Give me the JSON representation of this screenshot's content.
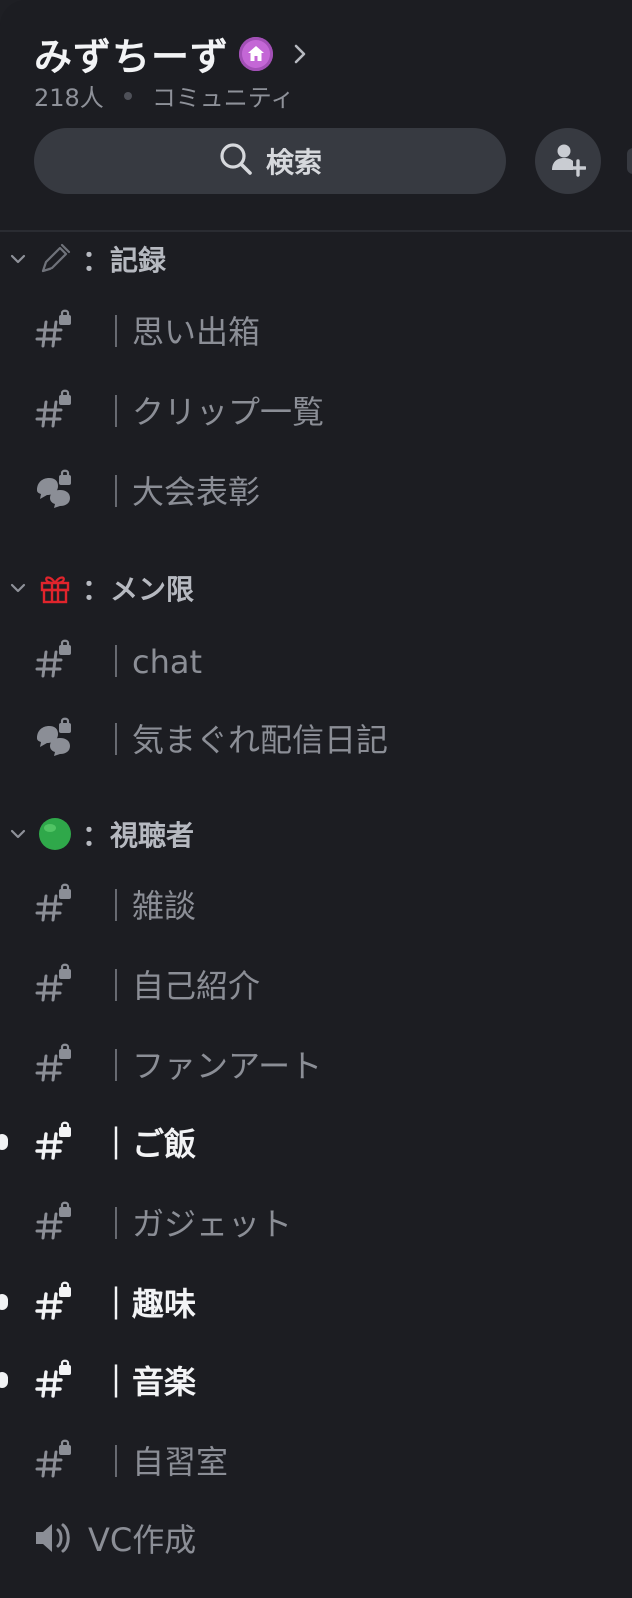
{
  "server": {
    "name": "みずちーず",
    "members": "218人",
    "type": "コミュニティ"
  },
  "search": {
    "label": "検索"
  },
  "categories": [
    {
      "name": "：記録",
      "emoji": "pencil-icon"
    },
    {
      "name": "：メン限",
      "emoji": "gift-icon"
    },
    {
      "name": "：視聴者",
      "emoji": "green-circle-icon"
    }
  ],
  "channels": [
    {
      "name": "｜思い出箱",
      "type": "text-locked"
    },
    {
      "name": "｜クリップ一覧",
      "type": "text-locked"
    },
    {
      "name": "｜大会表彰",
      "type": "forum-locked"
    },
    {
      "name": "｜chat",
      "type": "text-locked"
    },
    {
      "name": "｜気まぐれ配信日記",
      "type": "forum-locked"
    },
    {
      "name": "｜雑談",
      "type": "text-locked"
    },
    {
      "name": "｜自己紹介",
      "type": "text-locked"
    },
    {
      "name": "｜ファンアート",
      "type": "text-locked"
    },
    {
      "name": "｜ご飯",
      "type": "text-locked",
      "unread": true
    },
    {
      "name": "｜ガジェット",
      "type": "text-locked"
    },
    {
      "name": "｜趣味",
      "type": "text-locked",
      "unread": true
    },
    {
      "name": "｜音楽",
      "type": "text-locked",
      "unread": true
    },
    {
      "name": "｜自習室",
      "type": "text-locked"
    },
    {
      "name": "VC作成",
      "type": "voice"
    }
  ],
  "colors": {
    "background": "#1c1d22",
    "boost": "#c467d6",
    "unread_text": "#f2f3f5",
    "muted_text": "#8b8e96",
    "gift": "#e0242c",
    "green_circle": "#2fa84a"
  }
}
